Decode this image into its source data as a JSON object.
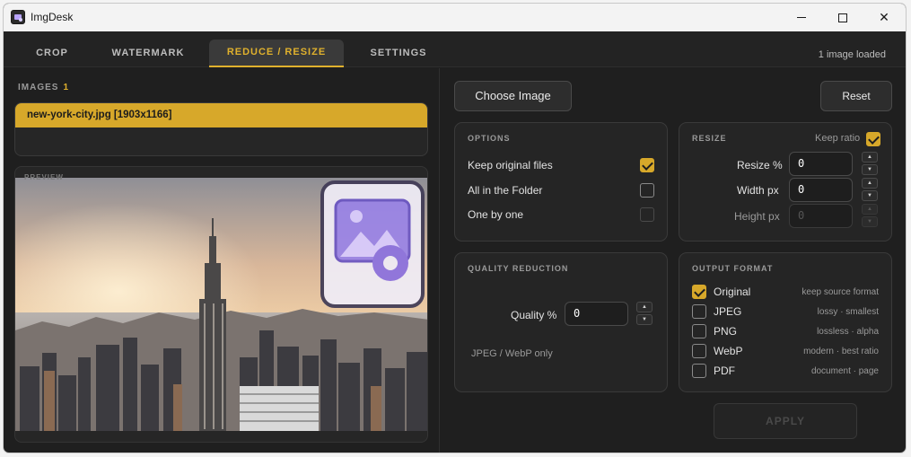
{
  "window": {
    "title": "ImgDesk",
    "controls": {
      "minimize": "minimize",
      "maximize": "maximize",
      "close": "✕"
    }
  },
  "tabs": [
    {
      "label": "CROP",
      "active": false
    },
    {
      "label": "WATERMARK",
      "active": false
    },
    {
      "label": "REDUCE / RESIZE",
      "active": true
    },
    {
      "label": "SETTINGS",
      "active": false
    }
  ],
  "status": "1 image loaded",
  "images": {
    "label": "IMAGES",
    "count": "1",
    "items": [
      "new-york-city.jpg [1903x1166]"
    ]
  },
  "preview": {
    "label": "PREVIEW"
  },
  "actions": {
    "choose": "Choose Image",
    "reset": "Reset",
    "apply": "APPLY"
  },
  "options": {
    "title": "OPTIONS",
    "items": [
      {
        "label": "Keep original files",
        "checked": true
      },
      {
        "label": "All in the Folder",
        "checked": false
      },
      {
        "label": "One by one",
        "checked": false
      }
    ]
  },
  "resize": {
    "title": "RESIZE",
    "keep_ratio_label": "Keep ratio",
    "keep_ratio": true,
    "fields": [
      {
        "label": "Resize %",
        "value": "0"
      },
      {
        "label": "Width px",
        "value": "0"
      },
      {
        "label": "Height px",
        "value": "0"
      }
    ]
  },
  "quality": {
    "title": "QUALITY REDUCTION",
    "label": "Quality %",
    "value": "0",
    "note": "JPEG / WebP only"
  },
  "output": {
    "title": "OUTPUT FORMAT",
    "formats": [
      {
        "label": "Original",
        "desc": "keep source format",
        "checked": true
      },
      {
        "label": "JPEG",
        "desc": "lossy · smallest",
        "checked": false
      },
      {
        "label": "PNG",
        "desc": "lossless · alpha",
        "checked": false
      },
      {
        "label": "WebP",
        "desc": "modern · best ratio",
        "checked": false
      },
      {
        "label": "PDF",
        "desc": "document · page",
        "checked": false
      }
    ]
  },
  "colors": {
    "accent": "#d7a82a",
    "background": "#1f1f1f",
    "panel": "#252525"
  }
}
